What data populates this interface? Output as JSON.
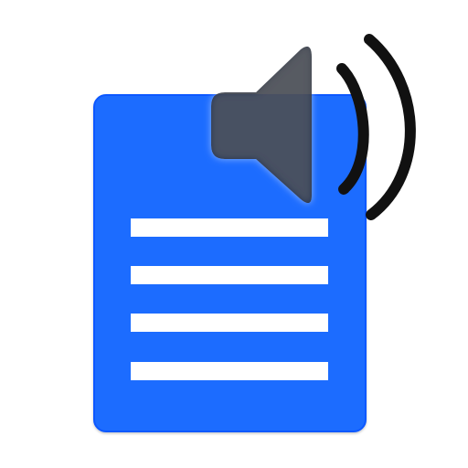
{
  "icon": {
    "name": "text-to-speech-app-icon",
    "document_icon": "document-icon",
    "speaker_icon": "speaker-volume-icon",
    "text_lines": 4,
    "sound_waves": 2
  },
  "colors": {
    "background": "#ffffff",
    "document": "#1e6cff",
    "document_border": "#0a58ff",
    "lines": "#ffffff",
    "speaker": "#172234",
    "speaker_overlay_opacity": 0.88,
    "waves": "#111111"
  }
}
